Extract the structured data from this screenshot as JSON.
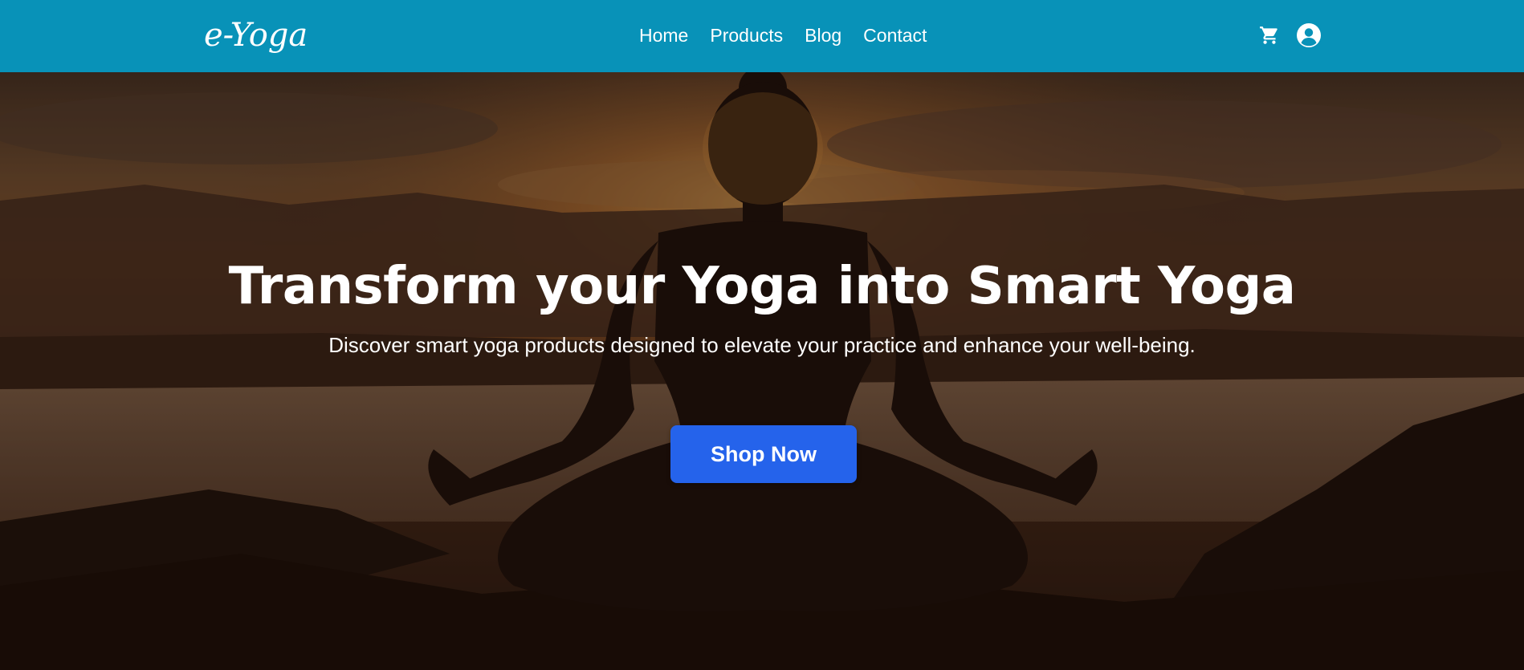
{
  "navbar": {
    "logo_text": "e-Yoga",
    "links": [
      {
        "label": "Home"
      },
      {
        "label": "Products"
      },
      {
        "label": "Blog"
      },
      {
        "label": "Contact"
      }
    ],
    "icons": {
      "cart": "cart-icon",
      "account": "user-account-icon"
    },
    "background_color": "#0892b8"
  },
  "hero": {
    "title": "Transform your Yoga into Smart Yoga",
    "subtitle": "Discover smart yoga products designed to elevate your practice and enhance your well-being.",
    "cta_label": "Shop Now",
    "cta_color": "#2563eb"
  }
}
